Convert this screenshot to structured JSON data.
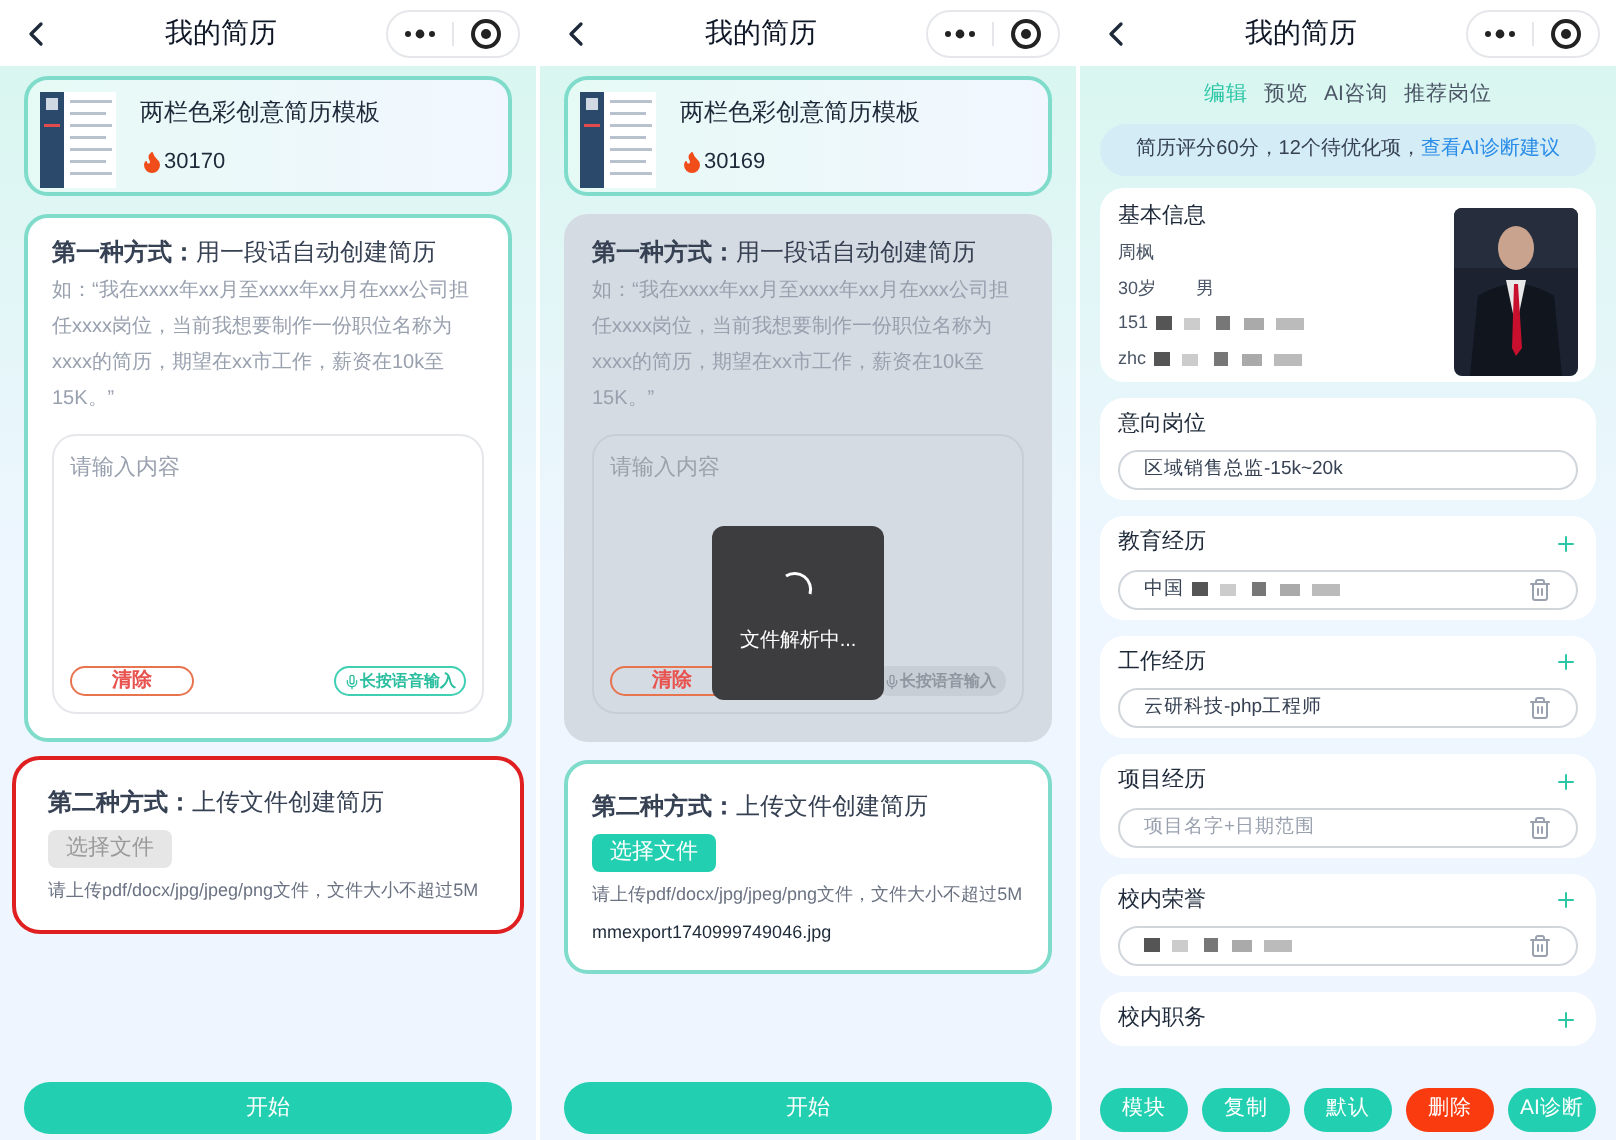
{
  "phones": [
    {
      "kind": "create",
      "title": "我的简历",
      "template": {
        "name": "两栏色彩创意简历模板",
        "count": "30170"
      },
      "method_one": {
        "label": "第一种方式：",
        "title": "用一段话自动创建简历",
        "example": "如：“我在xxxx年xx月至xxxx年xx月在xxx公司担任xxxx岗位，当前我想要制作一份职位名称为xxxx的简历，期望在xx市工作，薪资在10k至15K。”",
        "placeholder": "请输入内容",
        "clear": "清除",
        "voice": "长按语音输入",
        "dimmed": false
      },
      "method_two": {
        "label": "第二种方式：",
        "title": "上传文件创建简历",
        "button": "选择文件",
        "disabled": true,
        "hint": "请上传pdf/docx/jpg/jpeg/png文件，文件大小不超过5M",
        "highlighted": true
      },
      "start": "开始"
    },
    {
      "kind": "create",
      "title": "我的简历",
      "template": {
        "name": "两栏色彩创意简历模板",
        "count": "30169"
      },
      "method_one": {
        "label": "第一种方式：",
        "title": "用一段话自动创建简历",
        "example": "如：“我在xxxx年xx月至xxxx年xx月在xxx公司担任xxxx岗位，当前我想要制作一份职位名称为xxxx的简历，期望在xx市工作，薪资在10k至15K。”",
        "placeholder": "请输入内容",
        "clear": "清除",
        "voice": "长按语音输入",
        "dimmed": true
      },
      "method_two": {
        "label": "第二种方式：",
        "title": "上传文件创建简历",
        "button": "选择文件",
        "disabled": false,
        "hint": "请上传pdf/docx/jpg/jpeg/png文件，文件大小不超过5M",
        "file": "mmexport1740999749046.jpg",
        "highlighted": false
      },
      "loading": "文件解析中...",
      "start": "开始"
    },
    {
      "kind": "resume",
      "title": "我的简历",
      "tabs": [
        {
          "label": "编辑",
          "selected": true
        },
        {
          "label": "预览",
          "selected": false
        },
        {
          "label": "AI咨询",
          "selected": false
        },
        {
          "label": "推荐岗位",
          "selected": false
        }
      ],
      "score": {
        "text": "简历评分60分，12个待优化项，",
        "link": "查看AI诊断建议"
      },
      "basic": {
        "title": "基本信息",
        "name": "周枫",
        "age": "30岁",
        "gender": "男",
        "phone": "151",
        "email": "zhc"
      },
      "sections": [
        {
          "title": "意向岗位",
          "add": false,
          "field": {
            "value": "区域销售总监-15k~20k",
            "deletable": false
          }
        },
        {
          "title": "教育经历",
          "add": true,
          "field": {
            "value": "中国",
            "redacted": true,
            "deletable": true
          }
        },
        {
          "title": "工作经历",
          "add": true,
          "field": {
            "value": "云研科技-php工程师",
            "deletable": true
          }
        },
        {
          "title": "项目经历",
          "add": true,
          "field": {
            "placeholder": "项目名字+日期范围",
            "deletable": true
          }
        },
        {
          "title": "校内荣誉",
          "add": true,
          "field": {
            "redacted": true,
            "deletable": true
          }
        },
        {
          "title": "校内职务",
          "add": true
        }
      ],
      "actions": [
        {
          "label": "模块",
          "kind": "normal"
        },
        {
          "label": "复制",
          "kind": "normal"
        },
        {
          "label": "默认",
          "kind": "normal"
        },
        {
          "label": "删除",
          "kind": "danger"
        },
        {
          "label": "AI诊断",
          "kind": "normal"
        }
      ]
    }
  ]
}
